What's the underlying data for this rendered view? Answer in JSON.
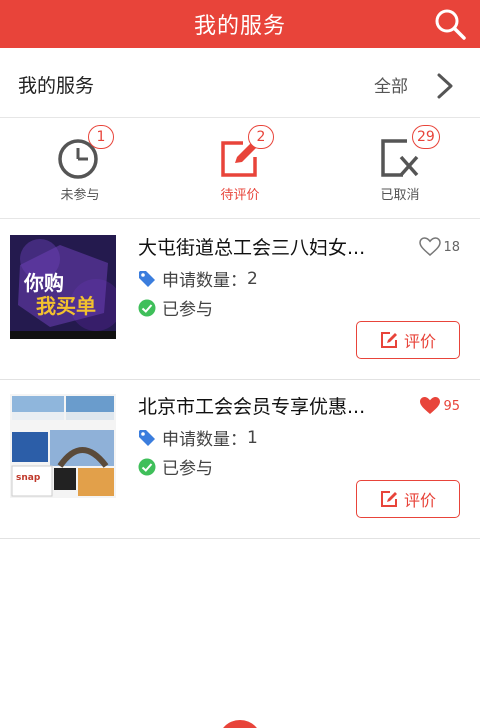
{
  "header": {
    "title": "我的服务"
  },
  "section": {
    "label": "我的服务",
    "all_label": "全部"
  },
  "tabs": [
    {
      "label": "未参与",
      "badge": "1",
      "icon": "clock-icon"
    },
    {
      "label": "待评价",
      "badge": "2",
      "icon": "edit-icon"
    },
    {
      "label": "已取消",
      "badge": "29",
      "icon": "cancel-icon"
    }
  ],
  "items": [
    {
      "title": "大屯街道总工会三八妇女...",
      "likes": "18",
      "liked": false,
      "apply_label": "申请数量：",
      "apply_count": "2",
      "status": "已参与",
      "rate_label": "评价"
    },
    {
      "title": "北京市工会会员专享优惠...",
      "likes": "95",
      "liked": true,
      "apply_label": "申请数量：",
      "apply_count": "1",
      "status": "已参与",
      "rate_label": "评价"
    }
  ],
  "colors": {
    "accent": "#e8443a",
    "success": "#3fbf5a",
    "tag": "#3b7ddd"
  }
}
